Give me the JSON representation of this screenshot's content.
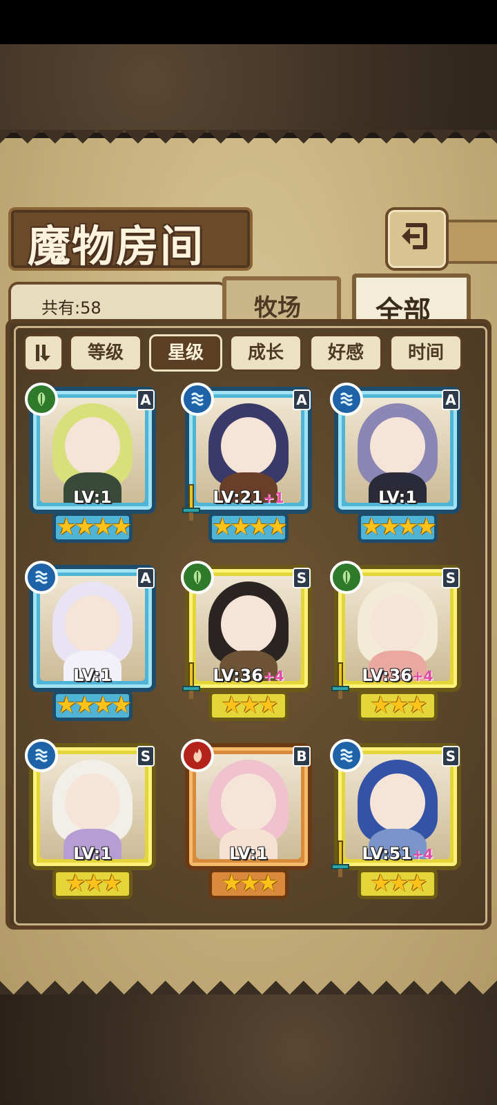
{
  "title": "魔物房间",
  "count_label": "共有:58",
  "tabs": {
    "pasture": "牧场",
    "all": "全部"
  },
  "sort": {
    "buttons": [
      "等级",
      "星级",
      "成长",
      "好感",
      "时间"
    ],
    "active": "星级"
  },
  "monsters": [
    {
      "element": "nature",
      "rank": "A",
      "level": "LV:1",
      "bonus": "",
      "stars": "★★★★",
      "has_weapon": false,
      "hair": "#d7e07a",
      "outfit": "#3a4a3a"
    },
    {
      "element": "water",
      "rank": "A",
      "level": "LV:21",
      "bonus": "+1",
      "stars": "★★★★",
      "has_weapon": true,
      "hair": "#3a3a6a",
      "outfit": "#6a3f2a"
    },
    {
      "element": "water",
      "rank": "A",
      "level": "LV:1",
      "bonus": "",
      "stars": "★★★★",
      "has_weapon": false,
      "hair": "#8c86b5",
      "outfit": "#2a2a38"
    },
    {
      "element": "water",
      "rank": "A",
      "level": "LV:1",
      "bonus": "",
      "stars": "★★★★",
      "has_weapon": false,
      "hair": "#e9e4f4",
      "outfit": "#f2f0f8"
    },
    {
      "element": "nature",
      "rank": "S",
      "level": "LV:36",
      "bonus": "+4",
      "stars": "★★★",
      "has_weapon": true,
      "hair": "#2a2422",
      "outfit": "#6e5336"
    },
    {
      "element": "nature",
      "rank": "S",
      "level": "LV:36",
      "bonus": "+4",
      "stars": "★★★",
      "has_weapon": true,
      "hair": "#f3ead7",
      "outfit": "#e9a9a0"
    },
    {
      "element": "water",
      "rank": "S",
      "level": "LV:1",
      "bonus": "",
      "stars": "★★★",
      "has_weapon": false,
      "hair": "#f2efe8",
      "outfit": "#b79ed2"
    },
    {
      "element": "fire",
      "rank": "B",
      "level": "LV:1",
      "bonus": "",
      "stars": "★★★",
      "has_weapon": false,
      "hair": "#f0c2cf",
      "outfit": "#f6e1d2"
    },
    {
      "element": "water",
      "rank": "S",
      "level": "LV:51",
      "bonus": "+4",
      "stars": "★★★",
      "has_weapon": true,
      "hair": "#3452a6",
      "outfit": "#7b94c9"
    }
  ]
}
